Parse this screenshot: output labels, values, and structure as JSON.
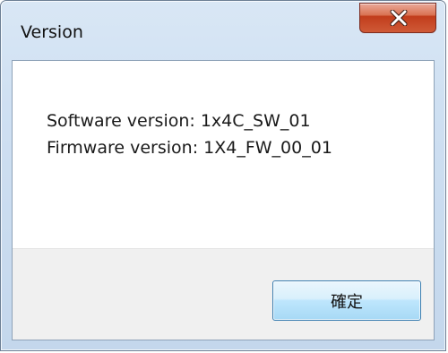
{
  "window": {
    "title": "Version",
    "close_icon": "close-x-icon"
  },
  "content": {
    "software_version": "Software version: 1x4C_SW_01",
    "firmware_version": "Firmware version: 1X4_FW_00_01"
  },
  "footer": {
    "ok_label": "確定"
  },
  "colors": {
    "frame": "#cfe0f2",
    "close_button": "#c94a2a",
    "footer_bg": "#f0f0f0",
    "ok_button": "#bee6fd"
  }
}
